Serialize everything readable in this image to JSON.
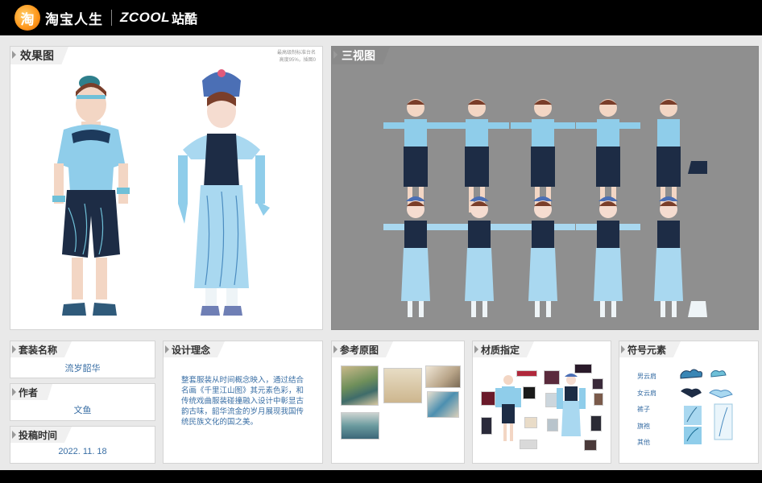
{
  "header": {
    "brand_taobao": "淘宝人生",
    "brand_zcool": "ZCOOL",
    "brand_zcool_cn": "站酷"
  },
  "render_panel": {
    "title": "效果图",
    "note_line1": "最高级制标准台名",
    "note_line2": "高度95%，插图0"
  },
  "three_view_panel": {
    "title": "三视图"
  },
  "suit_name": {
    "title": "套装名称",
    "value": "流岁韶华"
  },
  "author": {
    "title": "作者",
    "value": "文鱼"
  },
  "submit_time": {
    "title": "投稿时间",
    "value": "2022. 11. 18"
  },
  "design_concept": {
    "title": "设计理念",
    "text": "整套服装从时间概念映入，通过结合名画《千里江山图》其元素色彩，和传统戏曲服装碰撞融入设计中彰显古韵古味，韶华流金的岁月展现我国传统民族文化的国之美。"
  },
  "reference": {
    "title": "参考原图"
  },
  "materials": {
    "title": "材质指定"
  },
  "symbols": {
    "title": "符号元素",
    "items": [
      "男云肩",
      "女云肩",
      "裤子",
      "旗袍",
      "其他"
    ]
  },
  "colors": {
    "accent_blue": "#3a6fa5",
    "light_blue": "#a9d8f0",
    "dark_navy": "#1d2c45"
  }
}
